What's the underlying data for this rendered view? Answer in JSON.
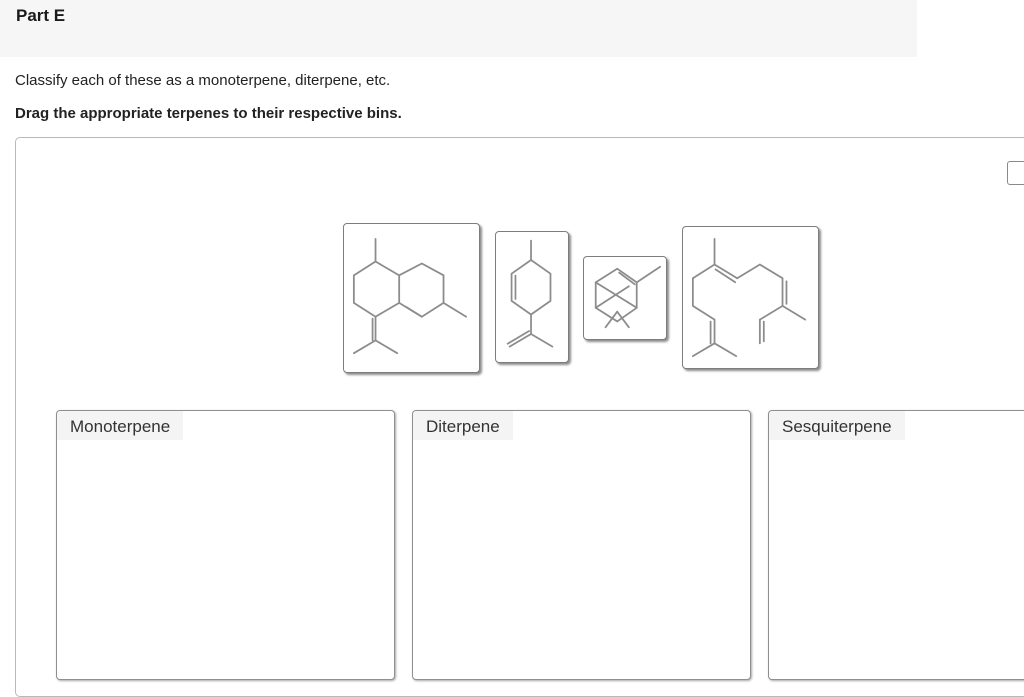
{
  "part": {
    "title": "Part E"
  },
  "instructions": {
    "text": "Classify each of these as a monoterpene, diterpene, etc.",
    "bold_text": "Drag the appropriate terpenes to their respective bins."
  },
  "tiles": [
    {
      "icon": "bicyclic-sesquiterpene-structure-icon"
    },
    {
      "icon": "limonene-structure-icon"
    },
    {
      "icon": "bicyclic-monoterpene-structure-icon"
    },
    {
      "icon": "acyclic-diterpene-structure-icon"
    }
  ],
  "bins": [
    {
      "label": "Monoterpene"
    },
    {
      "label": "Diterpene"
    },
    {
      "label": "Sesquiterpene"
    }
  ]
}
